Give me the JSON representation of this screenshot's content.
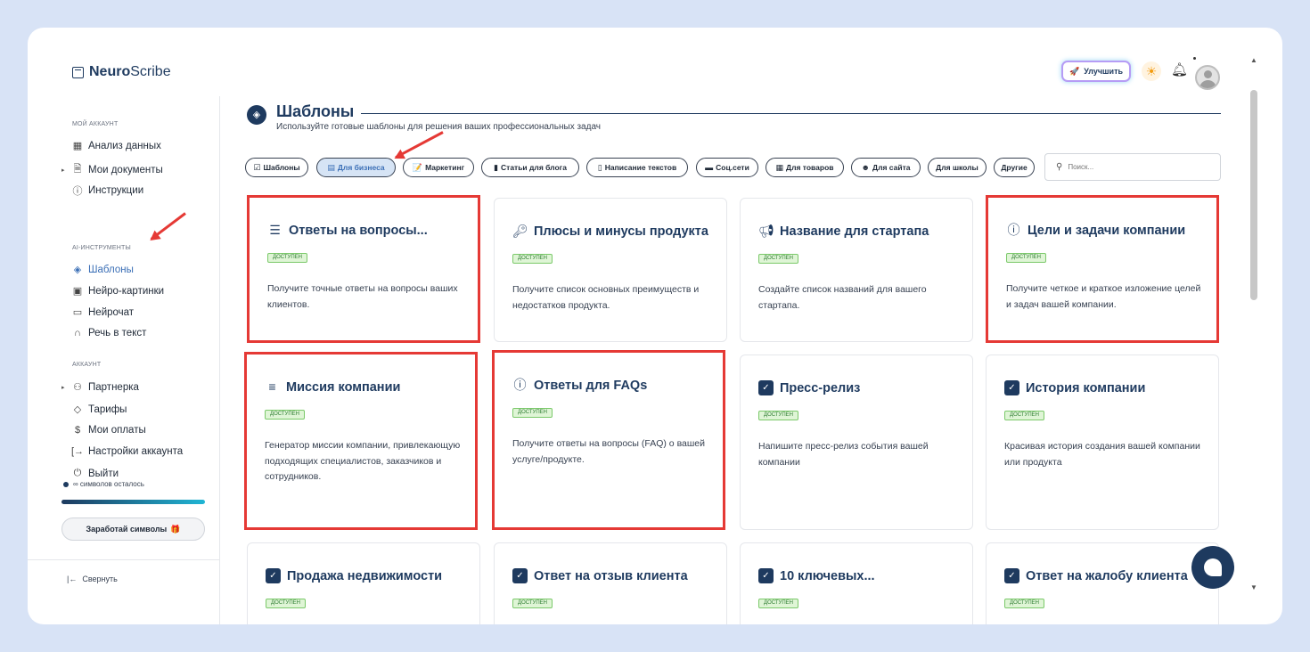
{
  "header": {
    "logo_bold": "Neuro",
    "logo_rest": "Scribe",
    "upgrade_label": "Улучшить"
  },
  "sidebar": {
    "sections": [
      {
        "label": "МОЙ АККАУНТ"
      },
      {
        "label": "AI-ИНСТРУМЕНТЫ"
      },
      {
        "label": "АККАУНТ"
      }
    ],
    "items": [
      {
        "label": "Анализ данных",
        "icon": "grid-icon"
      },
      {
        "label": "Мои документы",
        "icon": "document-icon"
      },
      {
        "label": "Инструкции",
        "icon": "help-circle-icon"
      },
      {
        "label": "Шаблоны",
        "icon": "layers-icon",
        "active": true
      },
      {
        "label": "Нейро-картинки",
        "icon": "image-icon"
      },
      {
        "label": "Нейрочат",
        "icon": "chat-icon"
      },
      {
        "label": "Речь в текст",
        "icon": "headphones-icon"
      },
      {
        "label": "Партнерка",
        "icon": "users-icon"
      },
      {
        "label": "Тарифы",
        "icon": "tag-icon"
      },
      {
        "label": "Мои оплаты",
        "icon": "dollar-icon"
      },
      {
        "label": "Настройки аккаунта",
        "icon": "logout-arrow-icon"
      },
      {
        "label": "Выйти",
        "icon": "power-icon"
      }
    ],
    "symbols_left": "∞ символов осталось",
    "earn_label": "Заработай символы",
    "collapse_label": "Свернуть"
  },
  "main": {
    "title": "Шаблоны",
    "subtitle": "Используйте готовые шаблоны для решения ваших профессиональных задач",
    "search_placeholder": "Поиск...",
    "chips": [
      {
        "label": "Шаблоны"
      },
      {
        "label": "Для бизнеса",
        "active": true
      },
      {
        "label": "Маркетинг"
      },
      {
        "label": "Статьи для блога"
      },
      {
        "label": "Написание текстов"
      },
      {
        "label": "Соц.сети"
      },
      {
        "label": "Для товаров"
      },
      {
        "label": "Для сайта"
      },
      {
        "label": "Для школы"
      },
      {
        "label": "Другие"
      }
    ],
    "cards": [
      {
        "title": "Ответы на вопросы...",
        "badge": "доступен",
        "desc": "Получите точные ответы на вопросы ваших клиентов.",
        "icon": "list-icon"
      },
      {
        "title": "Плюсы и минусы продукта",
        "badge": "доступен",
        "desc": "Получите список основных преимуществ и недостатков продукта.",
        "icon": "key-icon"
      },
      {
        "title": "Название для стартапа",
        "badge": "доступен",
        "desc": "Создайте список названий для вашего стартапа.",
        "icon": "megaphone-icon"
      },
      {
        "title": "Цели и задачи компании",
        "badge": "доступен",
        "desc": "Получите четкое и краткое изложение целей и задач вашей компании.",
        "icon": "info-icon"
      },
      {
        "title": "Миссия компании",
        "badge": "доступен",
        "desc": "Генератор миссии компании, привлекающую подходящих специалистов, заказчиков и сотрудников.",
        "icon": "text-lines-icon"
      },
      {
        "title": "Ответы для FAQs",
        "badge": "доступен",
        "desc": "Получите ответы на вопросы (FAQ) о вашей услуге/продукте.",
        "icon": "info-icon"
      },
      {
        "title": "Пресс-релиз",
        "badge": "доступен",
        "desc": "Напишите пресс-релиз события вашей компании",
        "icon": "checkbox-icon"
      },
      {
        "title": "История компании",
        "badge": "доступен",
        "desc": "Красивая история создания вашей компании или продукта",
        "icon": "checkbox-icon"
      },
      {
        "title": "Продажа недвижимости",
        "badge": "доступен",
        "desc": "",
        "icon": "checkbox-icon"
      },
      {
        "title": "Ответ на отзыв клиента",
        "badge": "доступен",
        "desc": "",
        "icon": "checkbox-icon"
      },
      {
        "title": "10 ключевых...",
        "badge": "доступен",
        "desc": "",
        "icon": "checkbox-icon"
      },
      {
        "title": "Ответ на жалобу клиента",
        "badge": "доступен",
        "desc": "",
        "icon": "checkbox-icon"
      }
    ]
  },
  "colors": {
    "brand": "#1e3a5f",
    "accent": "#3b6fb6",
    "highlight": "#e53935",
    "badge_bg": "#dff5d6"
  }
}
